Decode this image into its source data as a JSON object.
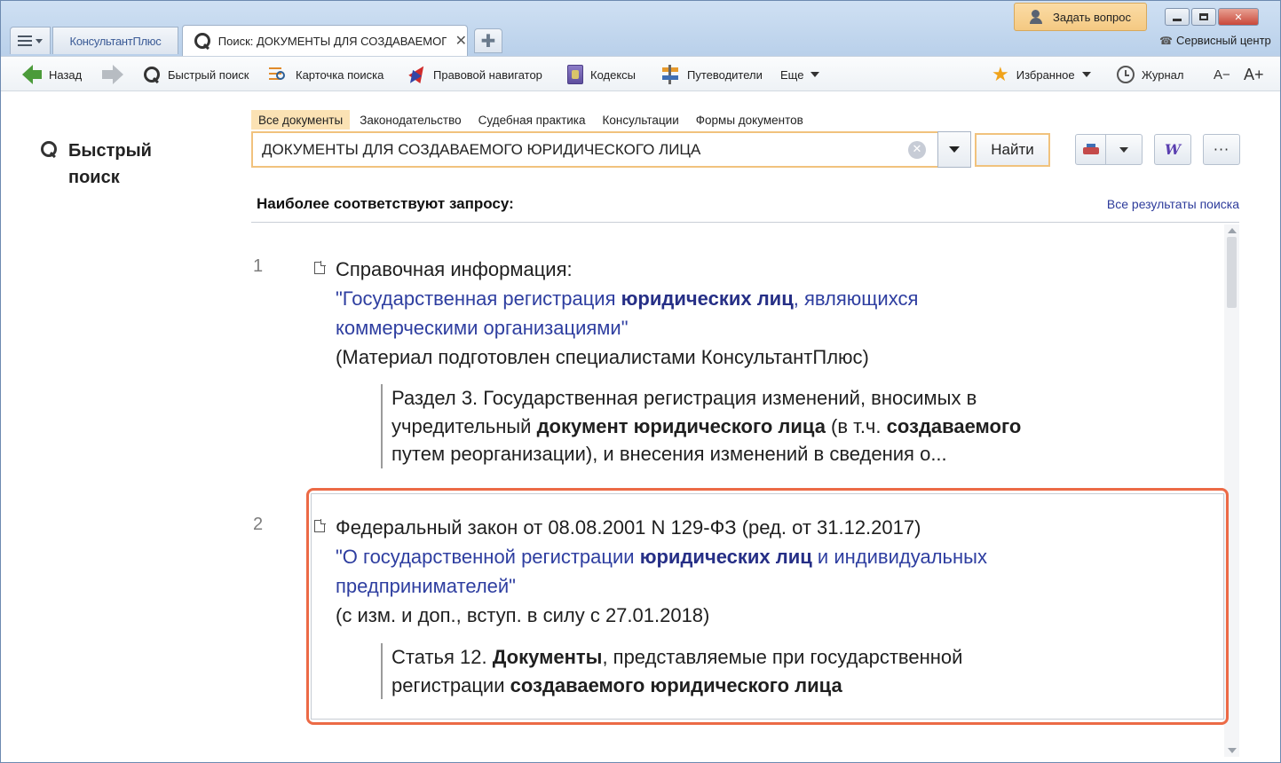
{
  "window": {
    "brand_tab": "КонсультантПлюс",
    "search_tab_title": "Поиск: ДОКУМЕНТЫ ДЛЯ СОЗДАВАЕМОГ",
    "tab_close": "✕",
    "new_tab": "✚",
    "ask_question": "Задать вопрос",
    "service_center": "Сервисный центр",
    "controls": {
      "minimize": "",
      "maximize": "",
      "close": "✕"
    }
  },
  "toolbar": {
    "back": "Назад",
    "quick_search": "Быстрый поиск",
    "search_card": "Карточка поиска",
    "legal_navigator": "Правовой навигатор",
    "codes": "Кодексы",
    "guides": "Путеводители",
    "more": "Еще",
    "favorites": "Избранное",
    "journal": "Журнал",
    "font_smaller": "A−",
    "font_larger": "A+"
  },
  "left_panel": {
    "title": "Быстрый поиск"
  },
  "category_tabs": [
    {
      "label": "Все документы",
      "active": true
    },
    {
      "label": "Законодательство",
      "active": false
    },
    {
      "label": "Судебная практика",
      "active": false
    },
    {
      "label": "Консультации",
      "active": false
    },
    {
      "label": "Формы документов",
      "active": false
    }
  ],
  "search": {
    "value": "ДОКУМЕНТЫ ДЛЯ СОЗДАВАЕМОГО ЮРИДИЧЕСКОГО ЛИЦА",
    "clear": "✕",
    "find_button": "Найти",
    "more_button": "···",
    "word_button": "W"
  },
  "results": {
    "header": "Наиболее соответствуют запросу:",
    "all_results_link": "Все результаты поиска",
    "items": [
      {
        "number": "1",
        "type_line": "Справочная информация:",
        "title_l1_a": "\"Государственная регистрация ",
        "title_l1_b": "юридических лиц",
        "title_l1_c": ", являющихся",
        "title_l2": "коммерческими организациями\"",
        "note": "(Материал подготовлен специалистами КонсультантПлюс)",
        "snippet_l1": "Раздел 3. Государственная регистрация изменений, вносимых в",
        "snippet_l2_a": "учредительный ",
        "snippet_l2_b": "документ юридического лица",
        "snippet_l2_c": " (в т.ч. ",
        "snippet_l2_d": "создаваемого",
        "snippet_l3": "путем реорганизации), и внесения изменений в сведения о..."
      },
      {
        "number": "2",
        "type_line": "Федеральный закон от 08.08.2001 N 129-ФЗ (ред. от 31.12.2017)",
        "title_l1_a": "\"О государственной регистрации ",
        "title_l1_b": "юридических лиц",
        "title_l1_c": " и индивидуальных",
        "title_l2": "предпринимателей\"",
        "note": "(с изм. и доп., вступ. в силу с 27.01.2018)",
        "snippet_l1_a": "Статья 12. ",
        "snippet_l1_b": "Документы",
        "snippet_l1_c": ", представляемые при государственной",
        "snippet_l2_a": "регистрации ",
        "snippet_l2_b": "создаваемого юридического лица"
      }
    ]
  },
  "colors": {
    "accent_orange": "#ec6a46",
    "link_blue": "#2e3ea0",
    "active_tab": "#fbe2b4",
    "search_border": "#f1c27d"
  }
}
